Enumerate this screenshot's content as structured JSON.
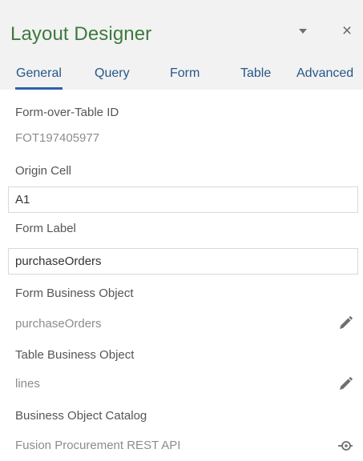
{
  "header": {
    "title": "Layout Designer",
    "close_glyph": "×"
  },
  "tabs": [
    {
      "label": "General",
      "active": true
    },
    {
      "label": "Query",
      "active": false
    },
    {
      "label": "Form",
      "active": false
    },
    {
      "label": "Table",
      "active": false
    },
    {
      "label": "Advanced",
      "active": false
    }
  ],
  "fields": {
    "form_over_table_id": {
      "label": "Form-over-Table ID",
      "value": "FOT197405977"
    },
    "origin_cell": {
      "label": "Origin Cell",
      "value": "A1"
    },
    "form_label": {
      "label": "Form Label",
      "value": "purchaseOrders"
    },
    "form_business_object": {
      "label": "Form Business Object",
      "value": "purchaseOrders",
      "icon": "pencil-icon"
    },
    "table_business_object": {
      "label": "Table Business Object",
      "value": "lines",
      "icon": "pencil-icon"
    },
    "business_object_catalog": {
      "label": "Business Object Catalog",
      "value": "Fusion Procurement REST API",
      "icon": "catalog-icon"
    }
  },
  "colors": {
    "title": "#3d7a3d",
    "tab_text": "#26578a",
    "tab_underline": "#2f62a8",
    "header_bg": "#f2f2f2"
  }
}
